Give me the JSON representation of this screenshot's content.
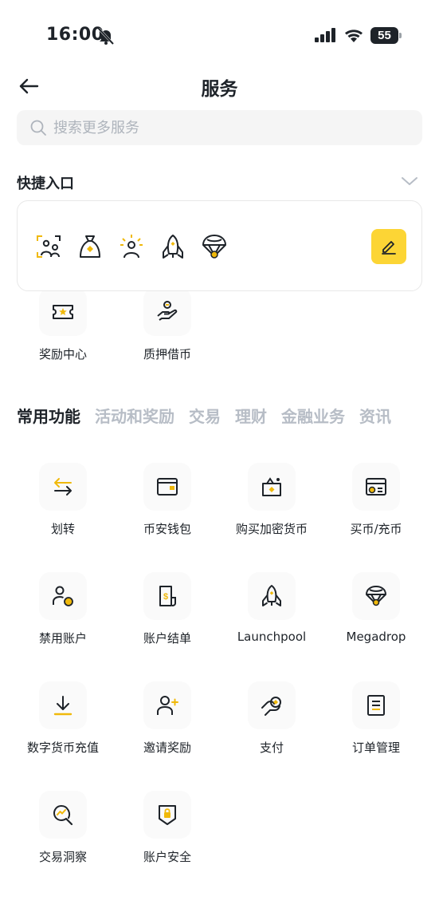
{
  "status_bar": {
    "time": "16:00",
    "battery": "55"
  },
  "header": {
    "title": "服务"
  },
  "search": {
    "placeholder": "搜索更多服务"
  },
  "quick_entry": {
    "title": "快捷入口",
    "icons": [
      "profile-scan-icon",
      "money-bag-icon",
      "sun-person-icon",
      "rocket-icon",
      "parachute-icon"
    ],
    "edit_icon": "edit-pen-icon"
  },
  "partial_row": [
    {
      "label": "奖励中心",
      "icon": "ticket-icon"
    },
    {
      "label": "质押借币",
      "icon": "hand-coin-icon"
    }
  ],
  "tabs": [
    {
      "label": "常用功能",
      "active": true
    },
    {
      "label": "活动和奖励"
    },
    {
      "label": "交易"
    },
    {
      "label": "理财"
    },
    {
      "label": "金融业务"
    },
    {
      "label": "资讯"
    }
  ],
  "features": [
    {
      "label": "划转",
      "icon": "transfer-icon"
    },
    {
      "label": "币安钱包",
      "icon": "wallet-icon"
    },
    {
      "label": "购买加密货币",
      "icon": "buy-crypto-icon"
    },
    {
      "label": "买币/充币",
      "icon": "card-deposit-icon"
    },
    {
      "label": "禁用账户",
      "icon": "disable-account-icon"
    },
    {
      "label": "账户结单",
      "icon": "statement-icon"
    },
    {
      "label": "Launchpool",
      "icon": "launchpool-rocket-icon"
    },
    {
      "label": "Megadrop",
      "icon": "megadrop-parachute-icon"
    },
    {
      "label": "数字货币充值",
      "icon": "download-icon"
    },
    {
      "label": "邀请奖励",
      "icon": "invite-user-icon"
    },
    {
      "label": "支付",
      "icon": "pay-icon"
    },
    {
      "label": "订单管理",
      "icon": "order-list-icon"
    },
    {
      "label": "交易洞察",
      "icon": "insight-icon"
    },
    {
      "label": "账户安全",
      "icon": "shield-lock-icon"
    }
  ],
  "colors": {
    "accent": "#fcd535",
    "text": "#1e2329",
    "muted": "#b7bdc6"
  }
}
